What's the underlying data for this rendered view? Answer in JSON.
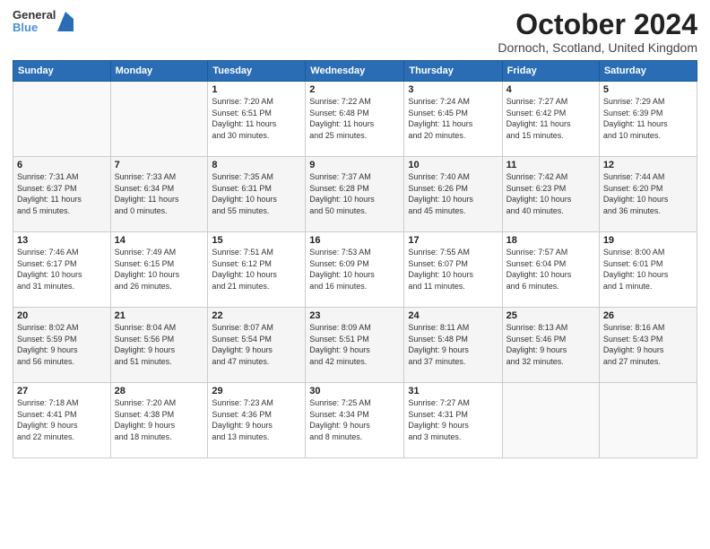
{
  "app": {
    "logo_line1": "General",
    "logo_line2": "Blue"
  },
  "header": {
    "month_title": "October 2024",
    "location": "Dornoch, Scotland, United Kingdom"
  },
  "weekdays": [
    "Sunday",
    "Monday",
    "Tuesday",
    "Wednesday",
    "Thursday",
    "Friday",
    "Saturday"
  ],
  "weeks": [
    [
      {
        "day": "",
        "info": ""
      },
      {
        "day": "",
        "info": ""
      },
      {
        "day": "1",
        "info": "Sunrise: 7:20 AM\nSunset: 6:51 PM\nDaylight: 11 hours\nand 30 minutes."
      },
      {
        "day": "2",
        "info": "Sunrise: 7:22 AM\nSunset: 6:48 PM\nDaylight: 11 hours\nand 25 minutes."
      },
      {
        "day": "3",
        "info": "Sunrise: 7:24 AM\nSunset: 6:45 PM\nDaylight: 11 hours\nand 20 minutes."
      },
      {
        "day": "4",
        "info": "Sunrise: 7:27 AM\nSunset: 6:42 PM\nDaylight: 11 hours\nand 15 minutes."
      },
      {
        "day": "5",
        "info": "Sunrise: 7:29 AM\nSunset: 6:39 PM\nDaylight: 11 hours\nand 10 minutes."
      }
    ],
    [
      {
        "day": "6",
        "info": "Sunrise: 7:31 AM\nSunset: 6:37 PM\nDaylight: 11 hours\nand 5 minutes."
      },
      {
        "day": "7",
        "info": "Sunrise: 7:33 AM\nSunset: 6:34 PM\nDaylight: 11 hours\nand 0 minutes."
      },
      {
        "day": "8",
        "info": "Sunrise: 7:35 AM\nSunset: 6:31 PM\nDaylight: 10 hours\nand 55 minutes."
      },
      {
        "day": "9",
        "info": "Sunrise: 7:37 AM\nSunset: 6:28 PM\nDaylight: 10 hours\nand 50 minutes."
      },
      {
        "day": "10",
        "info": "Sunrise: 7:40 AM\nSunset: 6:26 PM\nDaylight: 10 hours\nand 45 minutes."
      },
      {
        "day": "11",
        "info": "Sunrise: 7:42 AM\nSunset: 6:23 PM\nDaylight: 10 hours\nand 40 minutes."
      },
      {
        "day": "12",
        "info": "Sunrise: 7:44 AM\nSunset: 6:20 PM\nDaylight: 10 hours\nand 36 minutes."
      }
    ],
    [
      {
        "day": "13",
        "info": "Sunrise: 7:46 AM\nSunset: 6:17 PM\nDaylight: 10 hours\nand 31 minutes."
      },
      {
        "day": "14",
        "info": "Sunrise: 7:49 AM\nSunset: 6:15 PM\nDaylight: 10 hours\nand 26 minutes."
      },
      {
        "day": "15",
        "info": "Sunrise: 7:51 AM\nSunset: 6:12 PM\nDaylight: 10 hours\nand 21 minutes."
      },
      {
        "day": "16",
        "info": "Sunrise: 7:53 AM\nSunset: 6:09 PM\nDaylight: 10 hours\nand 16 minutes."
      },
      {
        "day": "17",
        "info": "Sunrise: 7:55 AM\nSunset: 6:07 PM\nDaylight: 10 hours\nand 11 minutes."
      },
      {
        "day": "18",
        "info": "Sunrise: 7:57 AM\nSunset: 6:04 PM\nDaylight: 10 hours\nand 6 minutes."
      },
      {
        "day": "19",
        "info": "Sunrise: 8:00 AM\nSunset: 6:01 PM\nDaylight: 10 hours\nand 1 minute."
      }
    ],
    [
      {
        "day": "20",
        "info": "Sunrise: 8:02 AM\nSunset: 5:59 PM\nDaylight: 9 hours\nand 56 minutes."
      },
      {
        "day": "21",
        "info": "Sunrise: 8:04 AM\nSunset: 5:56 PM\nDaylight: 9 hours\nand 51 minutes."
      },
      {
        "day": "22",
        "info": "Sunrise: 8:07 AM\nSunset: 5:54 PM\nDaylight: 9 hours\nand 47 minutes."
      },
      {
        "day": "23",
        "info": "Sunrise: 8:09 AM\nSunset: 5:51 PM\nDaylight: 9 hours\nand 42 minutes."
      },
      {
        "day": "24",
        "info": "Sunrise: 8:11 AM\nSunset: 5:48 PM\nDaylight: 9 hours\nand 37 minutes."
      },
      {
        "day": "25",
        "info": "Sunrise: 8:13 AM\nSunset: 5:46 PM\nDaylight: 9 hours\nand 32 minutes."
      },
      {
        "day": "26",
        "info": "Sunrise: 8:16 AM\nSunset: 5:43 PM\nDaylight: 9 hours\nand 27 minutes."
      }
    ],
    [
      {
        "day": "27",
        "info": "Sunrise: 7:18 AM\nSunset: 4:41 PM\nDaylight: 9 hours\nand 22 minutes."
      },
      {
        "day": "28",
        "info": "Sunrise: 7:20 AM\nSunset: 4:38 PM\nDaylight: 9 hours\nand 18 minutes."
      },
      {
        "day": "29",
        "info": "Sunrise: 7:23 AM\nSunset: 4:36 PM\nDaylight: 9 hours\nand 13 minutes."
      },
      {
        "day": "30",
        "info": "Sunrise: 7:25 AM\nSunset: 4:34 PM\nDaylight: 9 hours\nand 8 minutes."
      },
      {
        "day": "31",
        "info": "Sunrise: 7:27 AM\nSunset: 4:31 PM\nDaylight: 9 hours\nand 3 minutes."
      },
      {
        "day": "",
        "info": ""
      },
      {
        "day": "",
        "info": ""
      }
    ]
  ]
}
